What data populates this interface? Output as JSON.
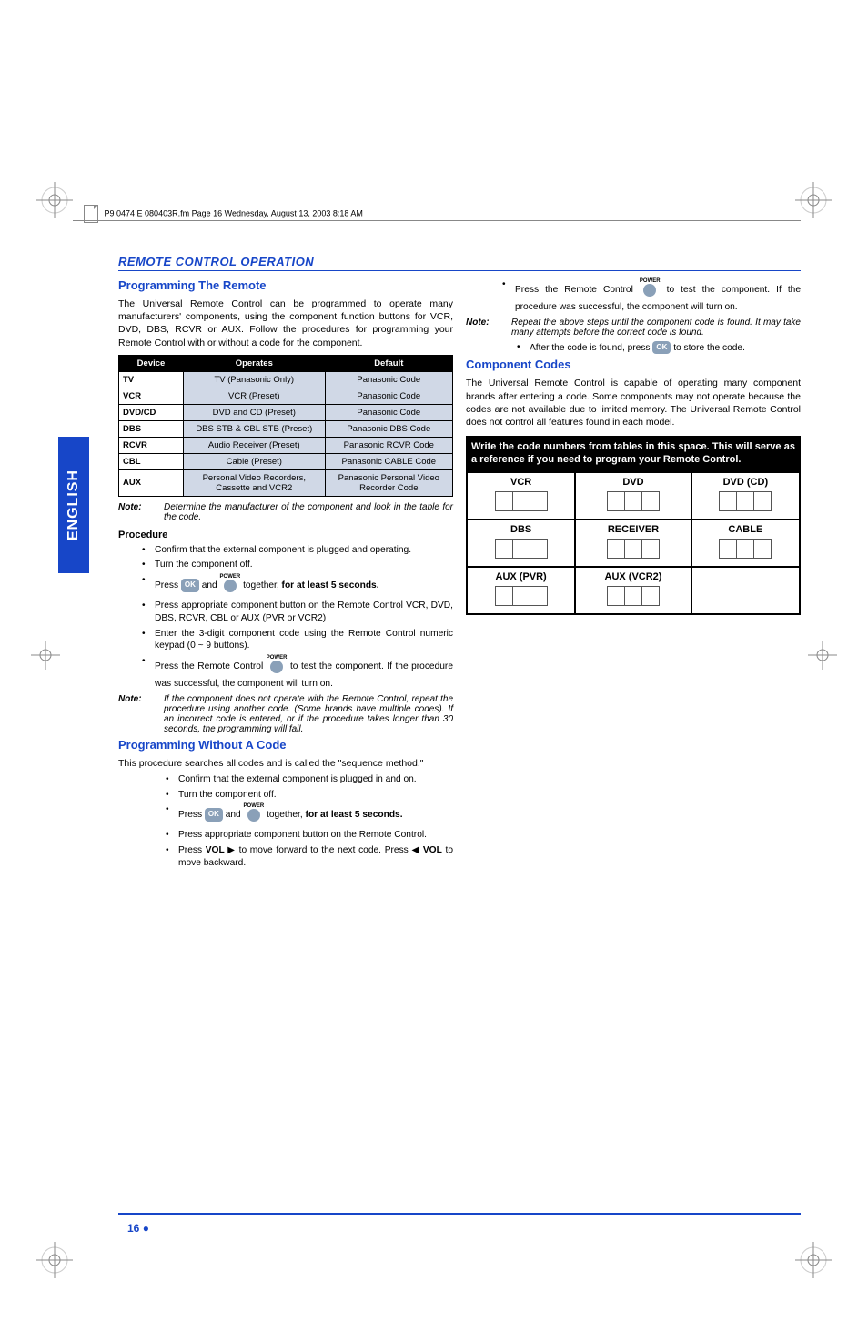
{
  "header_line": "P9 0474 E 080403R.fm  Page 16  Wednesday, August 13, 2003  8:18 AM",
  "tab_label": "ENGLISH",
  "section_header": "REMOTE CONTROL OPERATION",
  "left": {
    "h1": "Programming The Remote",
    "intro": "The Universal Remote Control can be programmed to operate many manufacturers' components, using the component function buttons for VCR, DVD, DBS, RCVR or AUX. Follow the procedures for programming your Remote Control with or without a code for the component.",
    "table": {
      "headers": [
        "Device",
        "Operates",
        "Default"
      ],
      "rows": [
        [
          "TV",
          "TV (Panasonic Only)",
          "Panasonic Code"
        ],
        [
          "VCR",
          "VCR (Preset)",
          "Panasonic Code"
        ],
        [
          "DVD/CD",
          "DVD and CD (Preset)",
          "Panasonic Code"
        ],
        [
          "DBS",
          "DBS STB & CBL STB (Preset)",
          "Panasonic DBS Code"
        ],
        [
          "RCVR",
          "Audio Receiver (Preset)",
          "Panasonic RCVR Code"
        ],
        [
          "CBL",
          "Cable (Preset)",
          "Panasonic CABLE Code"
        ],
        [
          "AUX",
          "Personal Video Recorders, Cassette and VCR2",
          "Panasonic Personal Video Recorder Code"
        ]
      ]
    },
    "note1_label": "Note:",
    "note1": "Determine the manufacturer of the component and look in the table for the code.",
    "procedure_h": "Procedure",
    "proc": [
      "Confirm that the external component is plugged and operating.",
      "Turn the component off."
    ],
    "proc_press_a": "Press ",
    "proc_press_and": " and ",
    "proc_press_b": " together, ",
    "proc_press_bold": "for at least 5 seconds.",
    "proc_more": [
      "Press appropriate component button on the Remote Control VCR, DVD, DBS, RCVR, CBL or AUX (PVR or VCR2)",
      "Enter the 3-digit component code using the Remote Control numeric keypad (0 ~ 9 buttons)."
    ],
    "proc_test_a": "Press the Remote Control ",
    "proc_test_b": " to test the component. If the procedure was successful, the component will turn on.",
    "note2_label": "Note:",
    "note2": "If the component does not operate with the Remote Control, repeat the procedure using another code. (Some brands have multiple codes). If an incorrect code is entered, or if the procedure takes longer than 30 seconds, the programming will fail.",
    "h2": "Programming Without A Code",
    "p2": "This procedure searches all codes and is called the \"sequence method.\"",
    "proc2": [
      "Confirm that the external component is plugged in and on.",
      "Turn the component off."
    ],
    "proc2_press_a": "Press ",
    "proc2_press_and": " and ",
    "proc2_press_b": " together, ",
    "proc2_press_bold": "for at least 5 seconds.",
    "proc2_more": "Press appropriate component button on the Remote Control.",
    "proc2_vol_a": "Press ",
    "proc2_vol_bold1": "VOL ",
    "proc2_vol_b": " to move forward to the next code. Press ",
    "proc2_vol_bold2": " VOL",
    "proc2_vol_c": " to move backward."
  },
  "right": {
    "press_remote_a": "Press the Remote Control ",
    "press_remote_b": " to test the component. If the procedure was successful, the component will turn on.",
    "note1_label": "Note:",
    "note1": "Repeat the above steps until the component code is found. It may take many attempts before the correct code is found.",
    "after_a": "After the code is found, press ",
    "after_b": " to store the code.",
    "h1": "Component Codes",
    "p1": "The Universal Remote Control is capable of operating many component brands after entering a code. Some components may not operate because the codes are not available due to limited memory. The Universal Remote Control does not control all features found in each model.",
    "banner": "Write the code numbers from tables in this space. This will serve as a reference if you need to program your Remote Control.",
    "codes": {
      "r1": [
        "VCR",
        "DVD",
        "DVD (CD)"
      ],
      "r2": [
        "DBS",
        "RECEIVER",
        "CABLE"
      ],
      "r3": [
        "AUX (PVR)",
        "AUX (VCR2)",
        ""
      ]
    }
  },
  "power_label": "POWER",
  "ok_label": "OK",
  "page_number": "16",
  "chart_data": {
    "type": "table",
    "title": "Device Operates Default",
    "categories": [
      "Device",
      "Operates",
      "Default"
    ],
    "series": [
      {
        "name": "TV",
        "values": [
          "TV (Panasonic Only)",
          "Panasonic Code"
        ]
      },
      {
        "name": "VCR",
        "values": [
          "VCR (Preset)",
          "Panasonic Code"
        ]
      },
      {
        "name": "DVD/CD",
        "values": [
          "DVD and CD (Preset)",
          "Panasonic Code"
        ]
      },
      {
        "name": "DBS",
        "values": [
          "DBS STB & CBL STB (Preset)",
          "Panasonic DBS Code"
        ]
      },
      {
        "name": "RCVR",
        "values": [
          "Audio Receiver (Preset)",
          "Panasonic RCVR Code"
        ]
      },
      {
        "name": "CBL",
        "values": [
          "Cable (Preset)",
          "Panasonic CABLE Code"
        ]
      },
      {
        "name": "AUX",
        "values": [
          "Personal Video Recorders, Cassette and VCR2",
          "Panasonic Personal Video Recorder Code"
        ]
      }
    ]
  }
}
